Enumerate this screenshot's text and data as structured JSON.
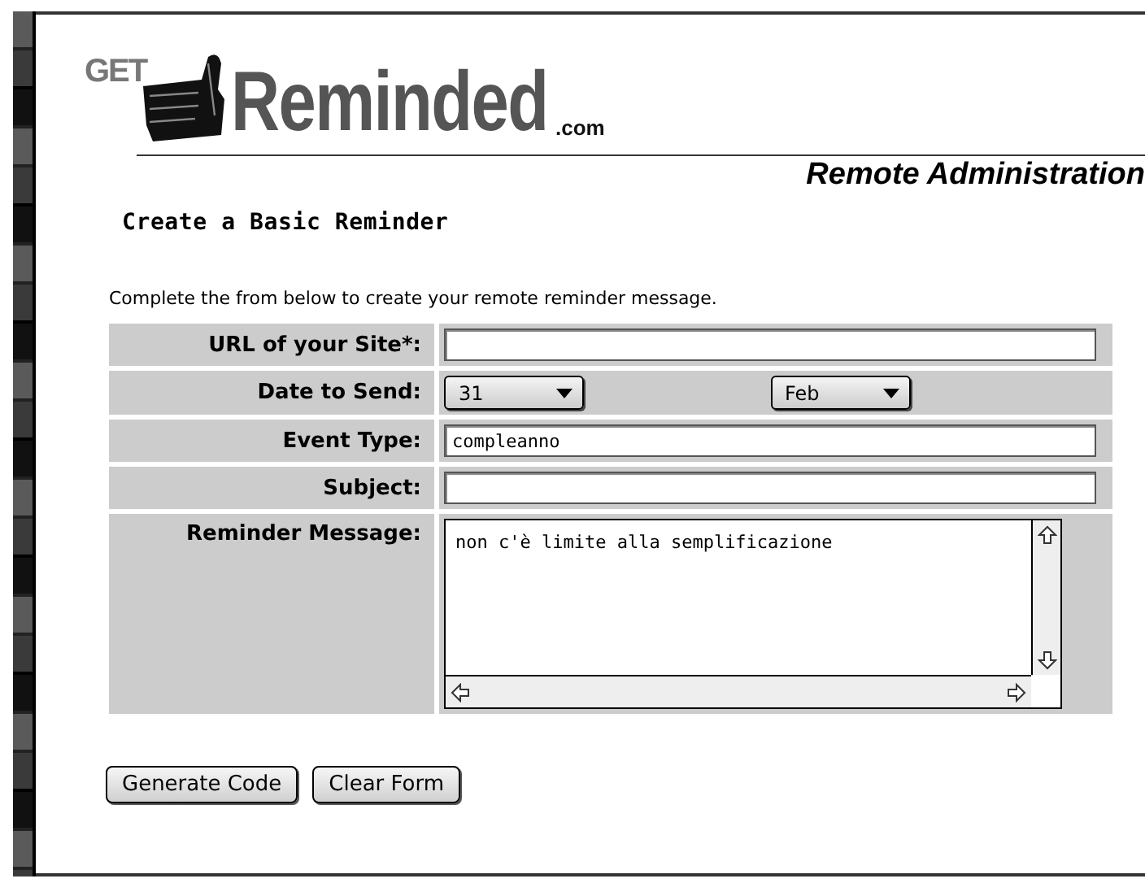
{
  "logo": {
    "prefix": "GET",
    "name": "Reminded",
    "suffix": ".com"
  },
  "section_title": "Remote Administration",
  "page_title": "Create a Basic Reminder",
  "instructions": "Complete the from below to create your remote reminder message.",
  "fields": [
    {
      "kind": "text",
      "label": "URL of your Site*:"
    },
    {
      "kind": "selects",
      "label": "Date to Send:",
      "selects": [
        "31",
        "Feb"
      ]
    },
    {
      "kind": "text",
      "label": "Event Type:",
      "value": "compleanno"
    },
    {
      "kind": "text",
      "label": "Subject:"
    },
    {
      "kind": "textarea",
      "label": "Reminder Message:",
      "value": "non c'è limite alla semplificazione"
    }
  ],
  "buttons": [
    "Generate Code",
    "Clear Form"
  ]
}
